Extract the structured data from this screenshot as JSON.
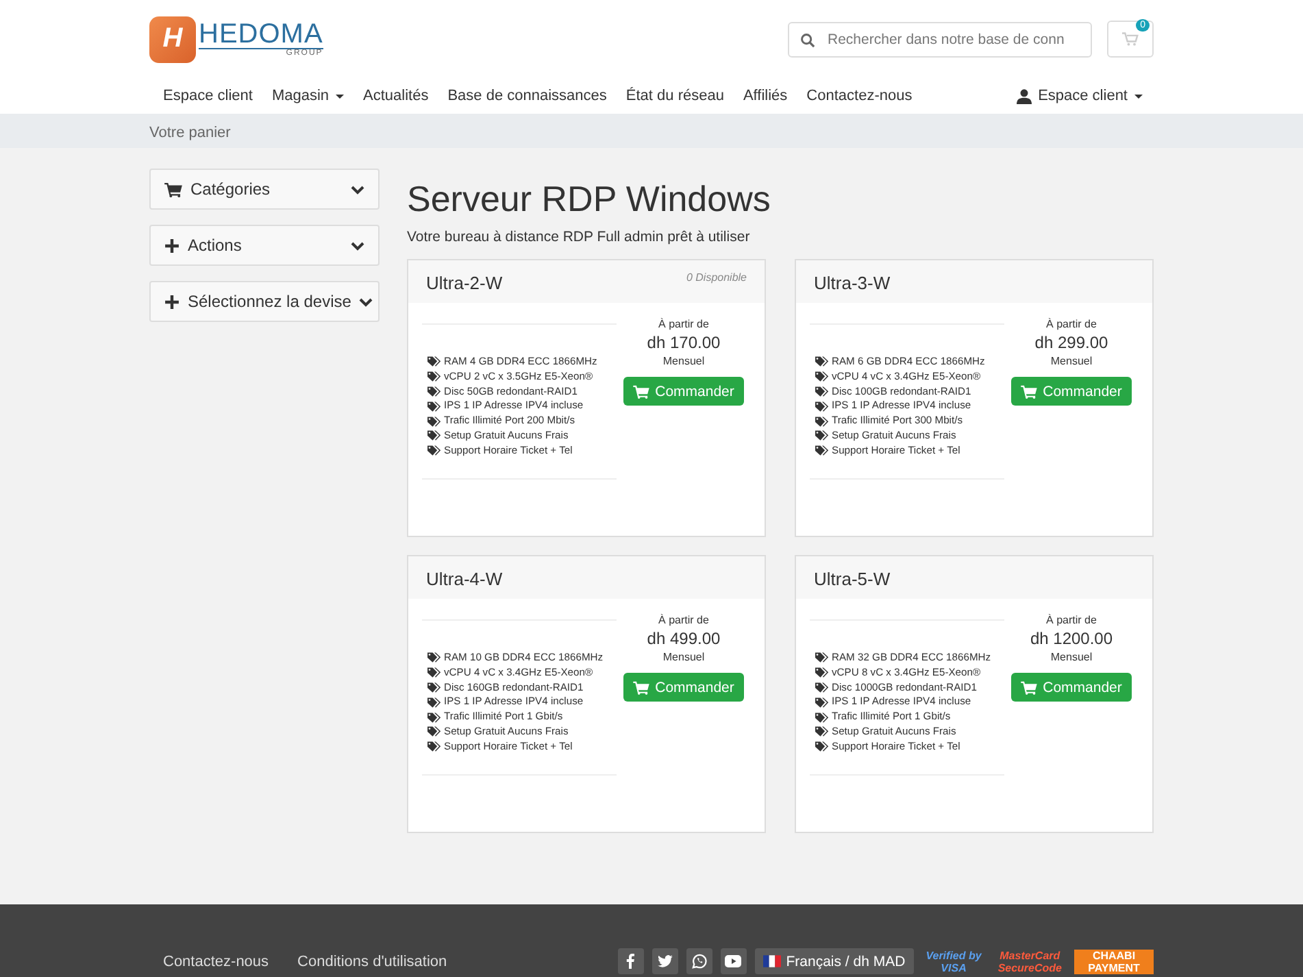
{
  "logo": {
    "mark": "H",
    "name": "HEDOMA",
    "sub": "GROUP"
  },
  "search": {
    "placeholder": "Rechercher dans notre base de conn"
  },
  "cart": {
    "count": "0"
  },
  "nav": [
    {
      "label": "Espace client",
      "dropdown": false
    },
    {
      "label": "Magasin",
      "dropdown": true
    },
    {
      "label": "Actualités",
      "dropdown": false
    },
    {
      "label": "Base de connaissances",
      "dropdown": false
    },
    {
      "label": "État du réseau",
      "dropdown": false
    },
    {
      "label": "Affiliés",
      "dropdown": false
    },
    {
      "label": "Contactez-nous",
      "dropdown": false
    }
  ],
  "account": {
    "label": "Espace client"
  },
  "breadcrumb": "Votre panier",
  "sidebar": [
    {
      "label": "Catégories",
      "kind": "categories"
    },
    {
      "label": "Actions",
      "kind": "actions"
    },
    {
      "label": "Sélectionnez la devise",
      "kind": "currency"
    }
  ],
  "page": {
    "title": "Serveur RDP Windows",
    "subtitle": "Votre bureau à distance RDP Full admin prêt à utiliser"
  },
  "products": [
    {
      "name": "Ultra-2-W",
      "stock": "0 Disponible",
      "from": "À partir de",
      "price": "dh 170.00",
      "cycle": "Mensuel",
      "button": "Commander",
      "features": [
        "RAM 4 GB DDR4 ECC 1866MHz",
        "vCPU 2 vC x 3.5GHz E5-Xeon®",
        "Disc 50GB redondant-RAID1",
        "IPS 1 IP Adresse IPV4 incluse",
        "Trafic Illimité Port 200 Mbit/s",
        "Setup Gratuit Aucuns Frais",
        "Support Horaire Ticket + Tel"
      ]
    },
    {
      "name": "Ultra-3-W",
      "from": "À partir de",
      "price": "dh 299.00",
      "cycle": "Mensuel",
      "button": "Commander",
      "features": [
        "RAM 6 GB DDR4 ECC 1866MHz",
        "vCPU 4 vC x 3.4GHz E5-Xeon®",
        "Disc 100GB redondant-RAID1",
        "IPS 1 IP Adresse IPV4 incluse",
        "Trafic Illimité Port 300 Mbit/s",
        "Setup Gratuit Aucuns Frais",
        "Support Horaire Ticket + Tel"
      ]
    },
    {
      "name": "Ultra-4-W",
      "from": "À partir de",
      "price": "dh 499.00",
      "cycle": "Mensuel",
      "button": "Commander",
      "features": [
        "RAM 10 GB DDR4 ECC 1866MHz",
        "vCPU 4 vC x 3.4GHz E5-Xeon®",
        "Disc 160GB redondant-RAID1",
        "IPS 1 IP Adresse IPV4 incluse",
        "Trafic Illimité Port 1 Gbit/s",
        "Setup Gratuit Aucuns Frais",
        "Support Horaire Ticket + Tel"
      ]
    },
    {
      "name": "Ultra-5-W",
      "from": "À partir de",
      "price": "dh 1200.00",
      "cycle": "Mensuel",
      "button": "Commander",
      "features": [
        "RAM 32 GB DDR4 ECC 1866MHz",
        "vCPU 8 vC x 3.4GHz E5-Xeon®",
        "Disc 1000GB redondant-RAID1",
        "IPS 1 IP Adresse IPV4 incluse",
        "Trafic Illimité Port 1 Gbit/s",
        "Setup Gratuit Aucuns Frais",
        "Support Horaire Ticket + Tel"
      ]
    }
  ],
  "footer": {
    "links": [
      "Contactez-nous",
      "Conditions d'utilisation"
    ],
    "social": [
      {
        "kind": "facebook"
      },
      {
        "kind": "twitter"
      },
      {
        "kind": "whatsapp"
      },
      {
        "kind": "youtube"
      }
    ],
    "language": "Français / dh MAD",
    "badges": [
      {
        "kind": "visa",
        "lines": [
          "Verified by",
          "VISA"
        ]
      },
      {
        "kind": "mastercard",
        "lines": [
          "MasterCard",
          "SecureCode"
        ]
      },
      {
        "kind": "chaabi",
        "lines": [
          "CHAABI",
          "PAYMENT"
        ]
      }
    ]
  }
}
